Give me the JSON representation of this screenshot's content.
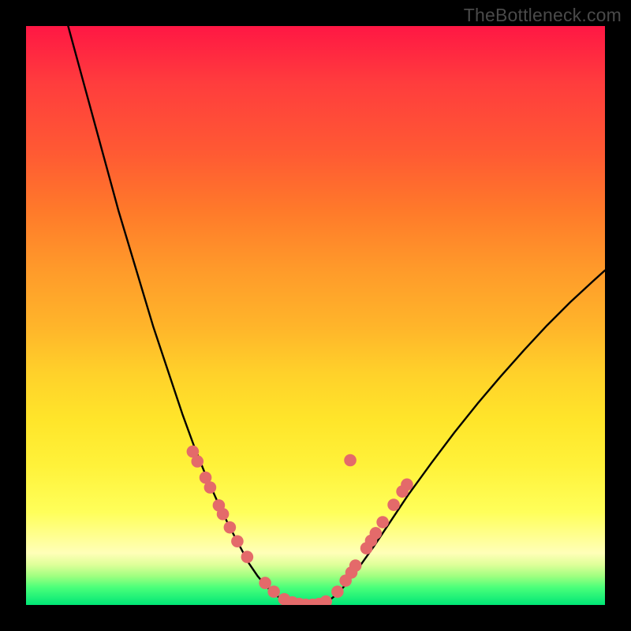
{
  "watermark": "TheBottleneck.com",
  "chart_data": {
    "type": "line",
    "title": "",
    "xlabel": "",
    "ylabel": "",
    "xlim": [
      0,
      100
    ],
    "ylim": [
      0,
      100
    ],
    "series": [
      {
        "name": "left-curve",
        "x": [
          7,
          10,
          13,
          16,
          19,
          22,
          25,
          27,
          29,
          31,
          33,
          35,
          37,
          38.5,
          40,
          41.5,
          43,
          44.5,
          46
        ],
        "y": [
          101,
          90,
          79,
          68,
          58,
          48,
          39,
          33,
          27.5,
          22.5,
          18,
          13.8,
          10,
          7.2,
          5,
          3.2,
          1.8,
          0.8,
          0.2
        ]
      },
      {
        "name": "trough",
        "x": [
          46,
          47,
          48,
          49,
          50,
          51
        ],
        "y": [
          0.2,
          0,
          0,
          0,
          0,
          0.2
        ]
      },
      {
        "name": "right-curve",
        "x": [
          51,
          52.5,
          54,
          55.5,
          57.5,
          60,
          63,
          66,
          70,
          74,
          78,
          82,
          86,
          90,
          94,
          98,
          100
        ],
        "y": [
          0.2,
          0.9,
          2.1,
          3.9,
          6.5,
          10,
          14.5,
          19,
          24.5,
          29.8,
          34.8,
          39.5,
          44,
          48.3,
          52.3,
          56,
          57.8
        ]
      }
    ],
    "scatter": {
      "name": "dots",
      "points": [
        [
          28.8,
          26.5
        ],
        [
          29.6,
          24.8
        ],
        [
          31.0,
          22.0
        ],
        [
          31.8,
          20.3
        ],
        [
          33.3,
          17.2
        ],
        [
          34.0,
          15.7
        ],
        [
          35.2,
          13.4
        ],
        [
          36.5,
          11.0
        ],
        [
          38.2,
          8.3
        ],
        [
          41.3,
          3.8
        ],
        [
          42.8,
          2.3
        ],
        [
          44.6,
          1.0
        ],
        [
          46.0,
          0.45
        ],
        [
          47.2,
          0.18
        ],
        [
          48.3,
          0.05
        ],
        [
          49.5,
          0.05
        ],
        [
          50.6,
          0.18
        ],
        [
          51.8,
          0.6
        ],
        [
          53.8,
          2.3
        ],
        [
          55.2,
          4.2
        ],
        [
          56.2,
          5.6
        ],
        [
          56.9,
          6.8
        ],
        [
          58.8,
          9.8
        ],
        [
          59.6,
          11.1
        ],
        [
          60.4,
          12.4
        ],
        [
          61.6,
          14.3
        ],
        [
          63.5,
          17.3
        ],
        [
          65.0,
          19.6
        ],
        [
          65.8,
          20.8
        ],
        [
          56.0,
          25.0
        ]
      ]
    },
    "colors": {
      "curve": "#000000",
      "dots": "#e46a6a"
    }
  }
}
